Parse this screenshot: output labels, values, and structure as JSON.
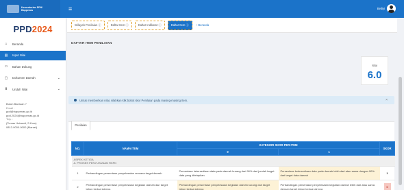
{
  "topbar": {
    "brand_line1": "Kementerian PPN/",
    "brand_line2": "Bappenas",
    "menu_icon": "hamburger-icon",
    "user_name": "Beltiyi"
  },
  "sidebar": {
    "logo_text": "PPD",
    "logo_year": "2024",
    "items": [
      {
        "label": "Beranda",
        "icon": "home-icon",
        "has_chevron": false
      },
      {
        "label": "Input Nilai",
        "icon": "edit-icon",
        "has_chevron": false,
        "active": true
      },
      {
        "label": "Bahan Dukung",
        "icon": "folder-icon",
        "has_chevron": false
      },
      {
        "label": "Dokumen Daerah",
        "icon": "monitor-icon",
        "has_chevron": true
      },
      {
        "label": "Unduh Nilai",
        "icon": "download-icon",
        "has_chevron": true
      }
    ],
    "help": {
      "title": "Butuh Bantuan ?",
      "email_label": "Email :",
      "email_1": "ppd@bappenas.go.id",
      "email_2": "ppd.2024@bappenas.go.id",
      "phone_label": "Telp :",
      "phone_1": "(Tomas Hutasoit, S.Kom)",
      "phone_2": "0812-0000-0000 (Marsel)"
    }
  },
  "tabs": [
    {
      "label": "Wilayah Penilaian ⓧ",
      "active": false
    },
    {
      "label": "Daftar Item ⓧ",
      "active": false
    },
    {
      "label": "Daftar Indikator ⓧ",
      "active": false
    },
    {
      "label": "Daftar Item ⓧ",
      "active": true
    }
  ],
  "tab_home": "• Beranda",
  "page_title": "DAFTAR ITEM PENILAIAN",
  "score_card": {
    "label": "Nilai",
    "value": "6.0"
  },
  "alert_text": "Untuk memberikan nilai, silahkan klik bobot skor Penilaian pada masing-masing Item.",
  "alert_close": "×",
  "card_tab": "Penilaian",
  "table": {
    "headers": {
      "no": "NO.",
      "item": "NAMA ITEM",
      "category": "KATEGORI SKOR PER ITEM",
      "score_0": "0",
      "score_1": "1",
      "skor": "SKOR"
    },
    "group_line1": "ASPEK KETIGA",
    "group_line2": "A. PROSES PENYUSUNAN RKPD",
    "rows": [
      {
        "no": "1",
        "item": "Perbandingan persentase penyelesaian rencana target daerah",
        "opt0": "Persentase ketersediaan data pada daerah kurang dari 90% dari jumlah target data yang ditetapkan",
        "opt1": "Persentase ketersediaan data pada daerah lebih dari atau sama dengan 90% dari target data daerah",
        "skor": "1",
        "warn": false
      },
      {
        "no": "2",
        "item": "Perbandingan persentase penyelesaian kegiatan daerah dan target tahun kedua lainnya",
        "opt0": "Perbandingan persentase penyelesaian kegiatan daerah kurang dari target tahun kedua lainnya",
        "opt1": "Perbandingan persentase penyelesaian kegiatan daerah lebih dari atau sama dengan target tahun kedua lainnya",
        "skor": "0",
        "warn": true
      }
    ]
  },
  "colors": {
    "primary": "#1b73c9",
    "accent": "#e8591a",
    "highlight": "#fdf2d6"
  }
}
